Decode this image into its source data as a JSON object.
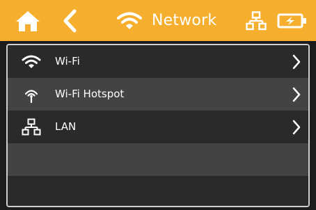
{
  "header": {
    "title": "Network",
    "background_color": "#f5ae2d",
    "icons": [
      "home-icon",
      "back-chevron-icon",
      "wifi-icon",
      "lan-icon",
      "battery-charging-icon"
    ]
  },
  "menu": {
    "items": [
      {
        "label": "Wi-Fi",
        "icon": "wifi-icon",
        "background": "#2a2a2a"
      },
      {
        "label": "Wi-Fi Hotspot",
        "icon": "hotspot-antenna-icon",
        "background": "#434343"
      },
      {
        "label": "LAN",
        "icon": "lan-icon",
        "background": "#2a2a2a"
      },
      {
        "label": "",
        "icon": "",
        "background": "#434343"
      },
      {
        "label": "",
        "icon": "",
        "background": "#2a2a2a"
      }
    ]
  }
}
